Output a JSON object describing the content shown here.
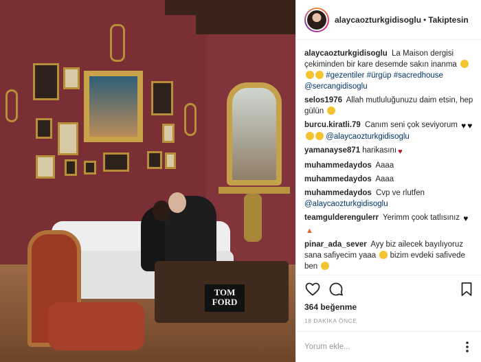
{
  "post": {
    "header": {
      "username": "alaycaozturkgidisoglu",
      "separator": "•",
      "follow_status": "Takiptesin"
    },
    "photo": {
      "book_title": "TOM FORD"
    },
    "comments": [
      {
        "user": "alaycaozturkgidisoglu",
        "text": "La Maison dergisi çekiminden bir kare desemde sakın inanma",
        "emojis": [
          "grin-emoji",
          "grin-emoji",
          "grin-emoji"
        ],
        "tags": [
          "#gezentiler",
          "#ürgüp",
          "#sacredhouse",
          "@sercangidisoglu"
        ]
      },
      {
        "user": "selos1976",
        "text": "Allah mutluluğunuzu daim etsin, hep gülün",
        "emojis": [
          "wink-emoji"
        ]
      },
      {
        "user": "burcu.kiratli.79",
        "text": "Canım seni çok seviyorum",
        "emojis": [
          "black-heart-emoji",
          "black-heart-emoji",
          "smile-emoji",
          "grin-emoji"
        ],
        "tags": [
          "@alaycaozturkgidisoglu"
        ]
      },
      {
        "user": "yamanayse871",
        "text": "harikasını",
        "emojis": [
          "red-heart-emoji"
        ]
      },
      {
        "user": "muhammedaydos",
        "text": "Aaaa"
      },
      {
        "user": "muhammedaydos",
        "text": "Aaaa"
      },
      {
        "user": "muhammedaydos",
        "text": "Cvp ve rlutfen",
        "tags": [
          "@alaycaozturkgidisoglu"
        ]
      },
      {
        "user": "teamgulderengulerr",
        "text": "Yerimm çook tatlısınız",
        "emojis": [
          "black-heart-emoji",
          "fire-emoji"
        ]
      },
      {
        "user": "pinar_ada_sever",
        "text": "Ayy biz ailecek bayılıyoruz sana safiyecim yaaa",
        "text_after": "bizim evdeki safivede ben",
        "emojis": [
          "grin-emoji",
          "grin-emoji"
        ]
      }
    ],
    "actions": {
      "like_icon": "heart-outline-icon",
      "comment_icon": "comment-bubble-icon",
      "save_icon": "bookmark-icon"
    },
    "likes_text": "364 beğenme",
    "timestamp": "18 DAKİKA ÖNCE",
    "add_comment": {
      "placeholder": "Yorum ekle...",
      "more_icon": "more-options-icon"
    },
    "colors": {
      "tag_link": "#003569",
      "muted": "#999999",
      "text": "#262626",
      "wall": "#7a2f35"
    }
  }
}
